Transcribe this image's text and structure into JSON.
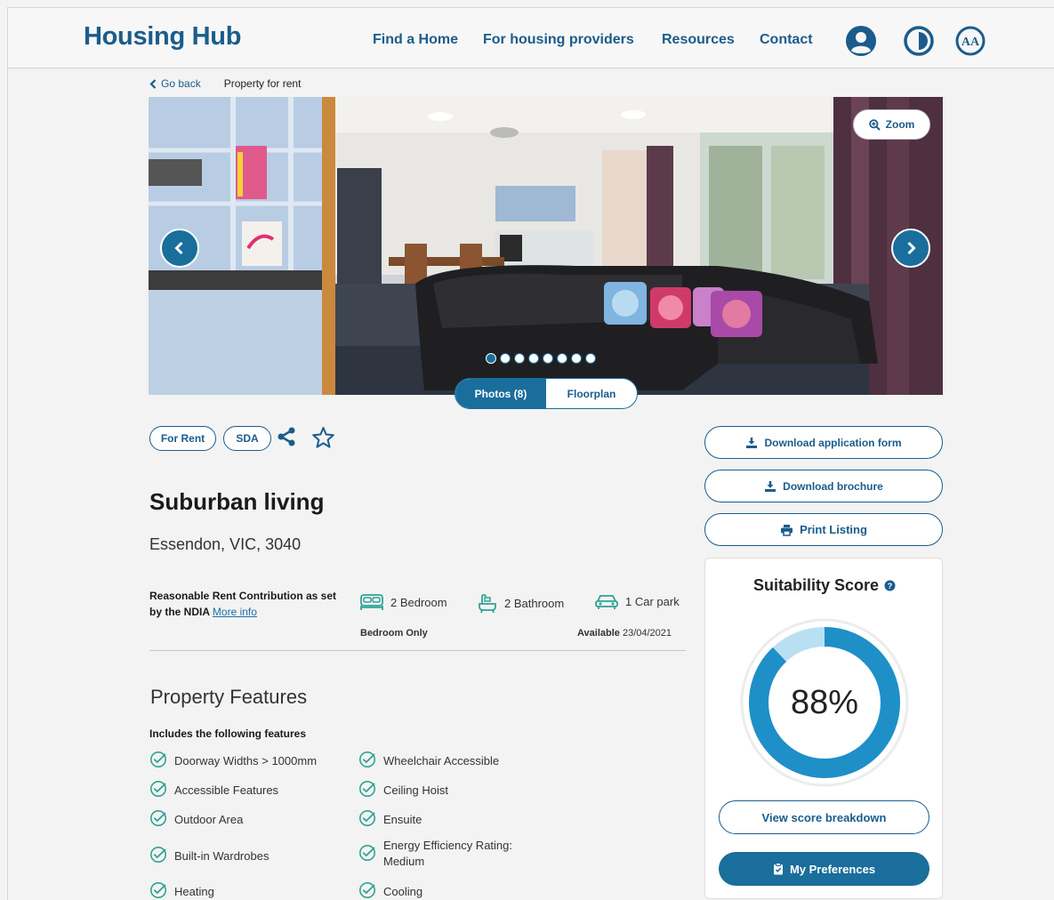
{
  "header": {
    "logo": "Housing Hub",
    "nav": [
      "Find a Home",
      "For housing providers",
      "Resources",
      "Contact"
    ],
    "icons": [
      "account-icon",
      "contrast-icon",
      "text-size-icon"
    ]
  },
  "breadcrumb": {
    "back": "Go back",
    "current": "Property for rent"
  },
  "gallery": {
    "zoom": "Zoom",
    "dots_count": 8,
    "active_dot": 0,
    "tabs": [
      "Photos (8)",
      "Floorplan"
    ],
    "active_tab": "Photos (8)"
  },
  "tags": [
    "For Rent",
    "SDA"
  ],
  "property": {
    "title": "Suburban living",
    "location": "Essendon, VIC, 3040",
    "rent_note": "Reasonable Rent Contribution as set by the NDIA",
    "more_info": "More info",
    "bedrooms": "2 Bedroom",
    "bathrooms": "2 Bathroom",
    "carpark": "1 Car park",
    "bedroom_only": "Bedroom Only",
    "available_label": "Available",
    "available_date": "23/04/2021"
  },
  "features": {
    "heading": "Property Features",
    "subheading": "Includes the following features",
    "left": [
      "Doorway Widths > 1000mm",
      "Accessible Features",
      "Outdoor Area",
      "Built-in Wardrobes",
      "Heating"
    ],
    "right": [
      "Wheelchair Accessible",
      "Ceiling Hoist",
      "Ensuite",
      "Energy Efficiency Rating: Medium",
      "Cooling"
    ]
  },
  "actions": {
    "download_form": "Download application form",
    "download_brochure": "Download brochure",
    "print": "Print Listing"
  },
  "score": {
    "title": "Suitability Score",
    "value_text": "88%",
    "value": 88,
    "view_breakdown": "View score breakdown",
    "preferences": "My Preferences"
  },
  "colors": {
    "brand": "#1b5c8c",
    "accent": "#1a6e9c",
    "ring": "#1f8fc8",
    "ring_track": "#b9e0f2",
    "check": "#2fa395"
  }
}
